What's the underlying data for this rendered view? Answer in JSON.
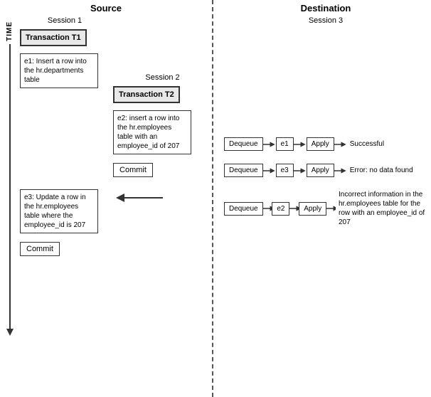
{
  "source": {
    "header": "Source",
    "session1": {
      "label": "Session 1",
      "transaction": "Transaction T1",
      "event1": "e1: Insert a row into the hr.departments table",
      "event3": "e3: Update a row in the hr.employees table where the employee_id is 207",
      "commit": "Commit"
    },
    "session2": {
      "label": "Session 2",
      "transaction": "Transaction T2",
      "event2": "e2: insert a row into the hr.employees table with an employee_id of 207",
      "commit": "Commit"
    }
  },
  "destination": {
    "header": "Destination",
    "session3": {
      "label": "Session 3",
      "row1": {
        "dequeue": "Dequeue",
        "event": "e1",
        "apply": "Apply",
        "result": "Successful"
      },
      "row2": {
        "dequeue": "Dequeue",
        "event": "e3",
        "apply": "Apply",
        "result": "Error: no data found"
      },
      "row3": {
        "dequeue": "Dequeue",
        "event": "e2",
        "apply": "Apply",
        "result": "Incorrect information in the hr.employees table for the row with an employee_id of 207"
      }
    }
  },
  "time_label": "TIME"
}
